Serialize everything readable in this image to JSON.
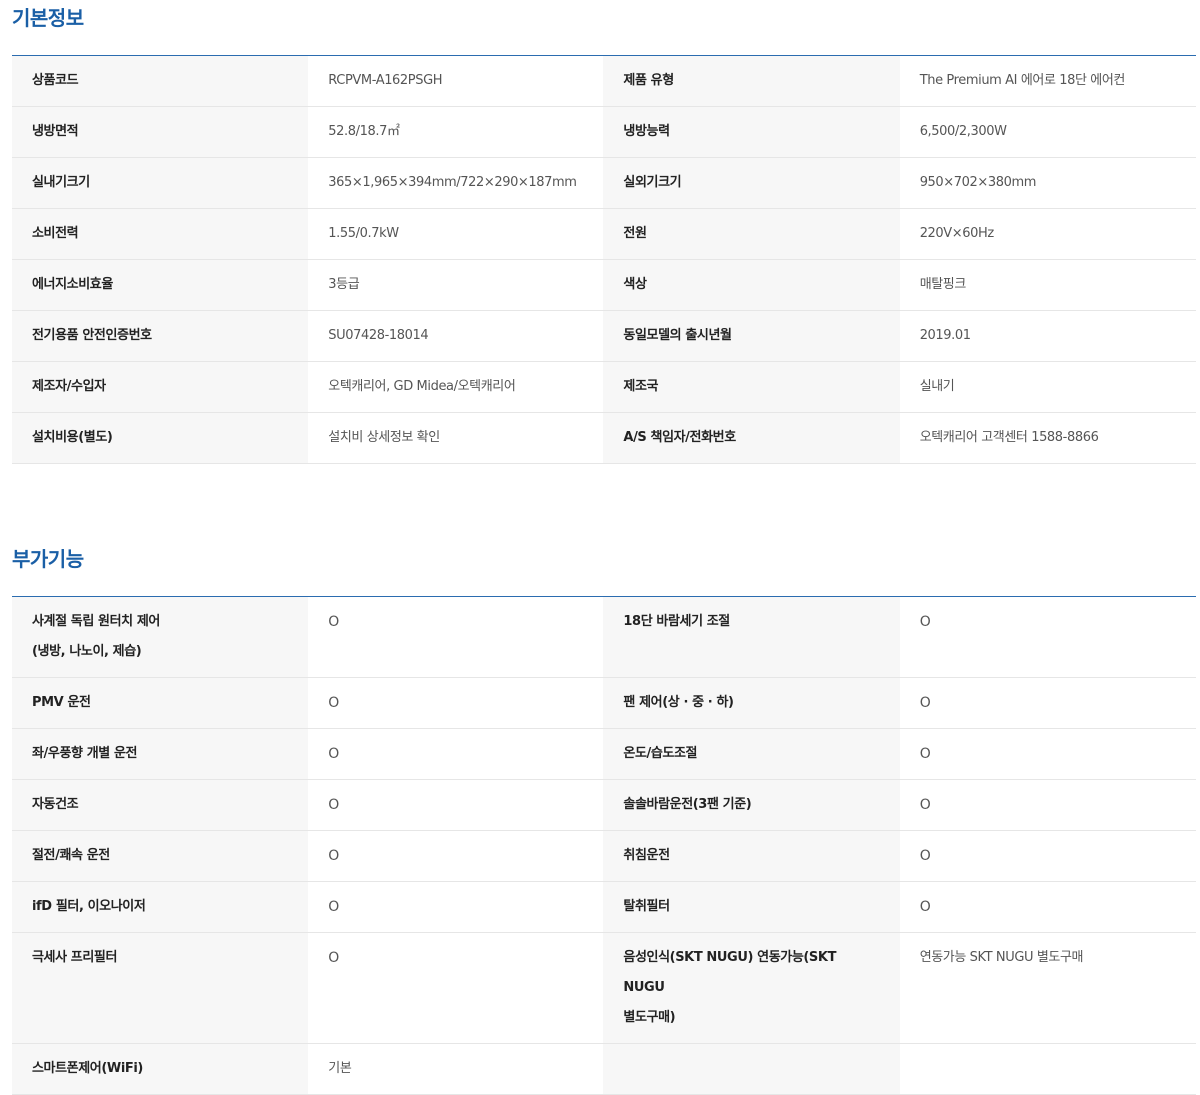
{
  "basic": {
    "title": "기본정보",
    "rows": [
      [
        "상품코드",
        "RCPVM-A162PSGH",
        "제품 유형",
        "The Premium AI 에어로 18단 에어컨"
      ],
      [
        "냉방면적",
        "52.8/18.7㎡",
        "냉방능력",
        "6,500/2,300W"
      ],
      [
        "실내기크기",
        "365×1,965×394mm/722×290×187mm",
        "실외기크기",
        "950×702×380mm"
      ],
      [
        "소비전력",
        "1.55/0.7kW",
        "전원",
        "220V×60Hz"
      ],
      [
        "에너지소비효율",
        "3등급",
        "색상",
        "매탈핑크"
      ],
      [
        "전기용품 안전인증번호",
        "SU07428-18014",
        "동일모델의 출시년월",
        "2019.01"
      ],
      [
        "제조자/수입자",
        "오텍캐리어, GD Midea/오텍캐리어",
        "제조국",
        "실내기"
      ],
      [
        "설치비용(별도)",
        "설치비 상세정보 확인",
        "A/S 책임자/전화번호",
        "오텍캐리어 고객센터 1588-8866"
      ]
    ]
  },
  "extra": {
    "title": "부가기능",
    "rows": [
      [
        "사계절 독립 원터치 제어",
        "(냉방, 나노이, 제습)",
        "O",
        "18단 바람세기 조절",
        "O"
      ],
      [
        "PMV 운전",
        "O",
        "팬 제어(상 · 중 · 하)",
        "O"
      ],
      [
        "좌/우풍향 개별 운전",
        "O",
        "온도/습도조절",
        "O"
      ],
      [
        "자동건조",
        "O",
        "솔솔바람운전(3팬 기준)",
        "O"
      ],
      [
        "절전/쾌속 운전",
        "O",
        "취침운전",
        "O"
      ],
      [
        "ifD 필터, 이오나이저",
        "O",
        "탈취필터",
        "O"
      ],
      [
        "극세사 프리필터",
        "O",
        "음성인식(SKT NUGU) 연동가능(SKT NUGU",
        "별도구매)",
        "연동가능 SKT NUGU 별도구매"
      ],
      [
        "스마트폰제어(WiFi)",
        "기본",
        "",
        ""
      ]
    ]
  }
}
